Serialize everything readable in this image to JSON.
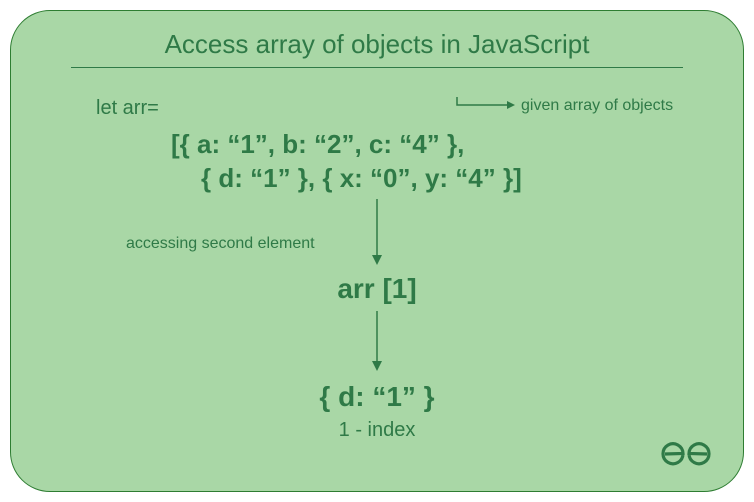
{
  "title": "Access array of objects in JavaScript",
  "declaration": "let arr=",
  "code_line1": "[{ a: “1”, b: “2”, c: “4” },",
  "code_line2": "{ d: “1” }, { x: “0”, y: “4” }]",
  "label_given": "given array of objects",
  "label_accessing": "accessing second element",
  "access_expr": "arr [1]",
  "result": "{ d: “1” }",
  "index_label": "1 - index",
  "colors": {
    "green": "#2f7a47",
    "bg": "#a9d7a6"
  }
}
